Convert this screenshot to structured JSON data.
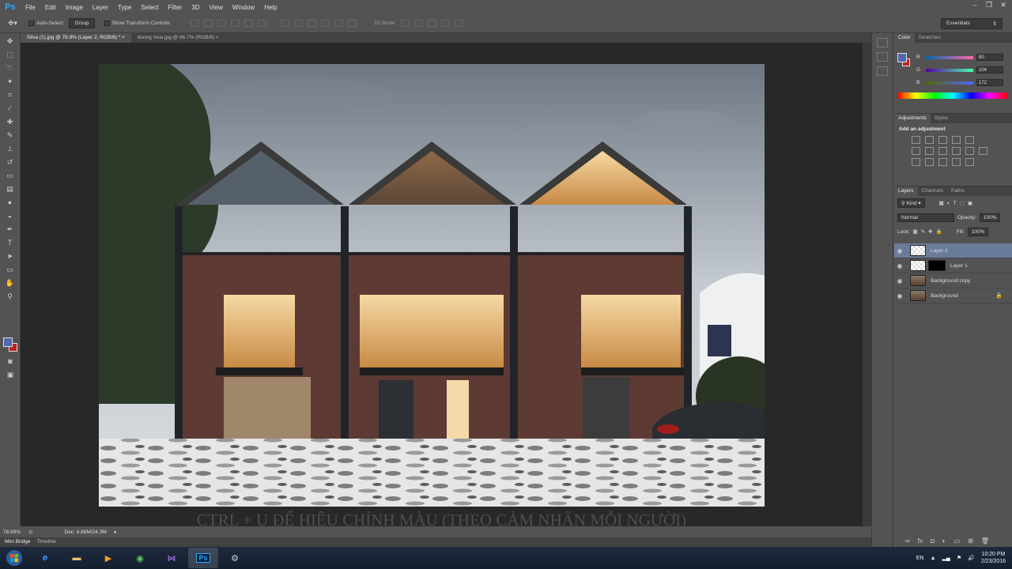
{
  "app": {
    "logo": "Ps"
  },
  "menu": [
    "File",
    "Edit",
    "Image",
    "Layer",
    "Type",
    "Select",
    "Filter",
    "3D",
    "View",
    "Window",
    "Help"
  ],
  "options": {
    "auto_select_label": "Auto-Select:",
    "auto_select_value": "Group",
    "show_transform_label": "Show Transform Controls",
    "mode_3d_label": "3D Mode:",
    "workspace": "Essentials"
  },
  "documents": [
    {
      "title": "Silva (1).jpg @ 78.9% (Layer 2, RGB/8) *",
      "close": "×"
    },
    {
      "title": "duong mua.jpg @ 66.7% (RGB/8)",
      "close": "×"
    }
  ],
  "canvas": {
    "caption": "CTRL + U ĐỂ HIỆU CHỈNH MÀU (THEO CẢM NHẬN MỖI NGƯỜI)"
  },
  "status": {
    "zoom": "78.89%",
    "doc": "Doc: 4.88M/24.3M"
  },
  "bottom_tabs": [
    "Mini Bridge",
    "Timeline"
  ],
  "color_panel": {
    "tabs": [
      "Color",
      "Swatches"
    ],
    "channels": [
      {
        "label": "R",
        "value": "80"
      },
      {
        "label": "G",
        "value": "104"
      },
      {
        "label": "B",
        "value": "172"
      }
    ],
    "fg_color": "#5068ac",
    "bg_color": "#c02020"
  },
  "adjustments": {
    "tabs": [
      "Adjustments",
      "Styles"
    ],
    "title": "Add an adjustment"
  },
  "layers_panel": {
    "tabs": [
      "Layers",
      "Channels",
      "Paths"
    ],
    "kind_label": "Kind",
    "blend_mode": "Normal",
    "opacity_label": "Opacity:",
    "opacity_value": "100%",
    "lock_label": "Lock:",
    "fill_label": "Fill:",
    "fill_value": "100%",
    "layers": [
      {
        "name": "Layer 2",
        "active": true
      },
      {
        "name": "Layer 1",
        "active": false
      },
      {
        "name": "Background copy",
        "active": false
      },
      {
        "name": "Background",
        "active": false
      }
    ]
  },
  "taskbar": {
    "language": "EN",
    "time": "10:20 PM",
    "date": "2/23/2016",
    "photoshop_label": "Ps"
  }
}
